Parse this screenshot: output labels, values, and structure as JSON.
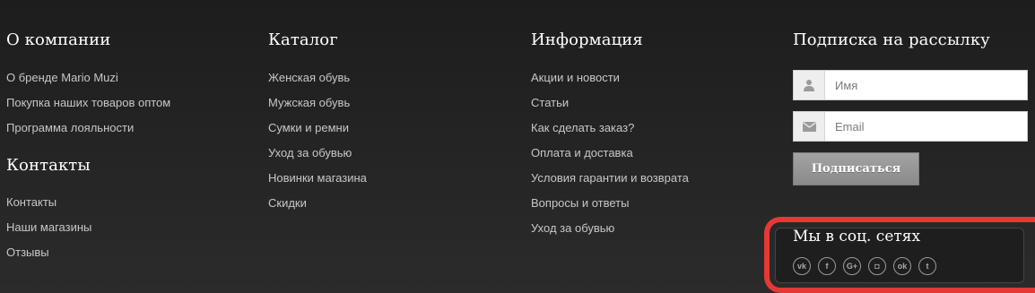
{
  "company": {
    "heading": "О компании",
    "links": [
      "О бренде Mario Muzi",
      "Покупка наших товаров оптом",
      "Программа лояльности"
    ]
  },
  "contacts": {
    "heading": "Контакты",
    "links": [
      "Контакты",
      "Наши магазины",
      "Отзывы"
    ]
  },
  "catalog": {
    "heading": "Каталог",
    "links": [
      "Женская обувь",
      "Мужская обувь",
      "Сумки и ремни",
      "Уход за обувью",
      "Новинки магазина",
      "Скидки"
    ]
  },
  "info": {
    "heading": "Информация",
    "links": [
      "Акции и новости",
      "Статьи",
      "Как сделать заказ?",
      "Оплата и доставка",
      "Условия гарантии и возврата",
      "Вопросы и ответы",
      "Уход за обувью"
    ]
  },
  "subscribe": {
    "heading": "Подписка на рассылку",
    "name_placeholder": "Имя",
    "email_placeholder": "Email",
    "button_label": "Подписаться"
  },
  "social": {
    "heading": "Мы в соц. сетях",
    "icons": [
      {
        "name": "vk-icon",
        "glyph": "vk"
      },
      {
        "name": "facebook-icon",
        "glyph": "f"
      },
      {
        "name": "google-plus-icon",
        "glyph": "G+"
      },
      {
        "name": "instagram-icon",
        "glyph": "◘"
      },
      {
        "name": "odnoklassniki-icon",
        "glyph": "ok"
      },
      {
        "name": "twitter-icon",
        "glyph": "t"
      }
    ]
  },
  "colors": {
    "background": "#222222",
    "heading_text": "#ffffff",
    "link_text": "#c7c7c7",
    "highlight_frame": "#e53935",
    "button": "#959595"
  }
}
